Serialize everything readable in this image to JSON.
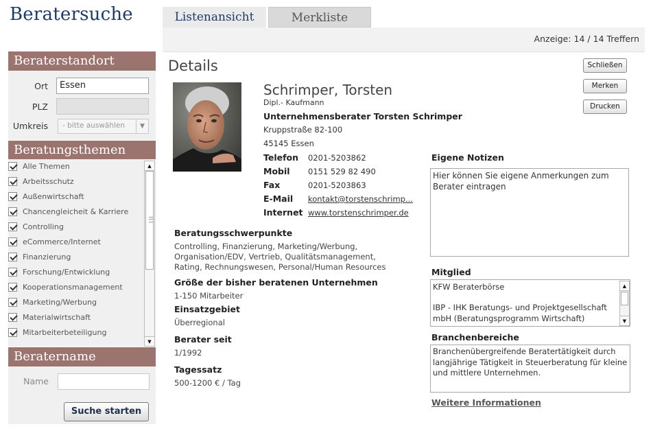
{
  "app": {
    "title": "Beratersuche"
  },
  "standort": {
    "heading": "Beraterstandort",
    "ort_label": "Ort",
    "ort_value": "Essen",
    "plz_label": "PLZ",
    "plz_value": "",
    "umkreis_label": "Umkreis",
    "umkreis_value": "- bitte auswählen"
  },
  "themen": {
    "heading": "Beratungsthemen",
    "items": [
      {
        "label": "Alle Themen",
        "checked": true
      },
      {
        "label": "Arbeitsschutz",
        "checked": true
      },
      {
        "label": "Außenwirtschaft",
        "checked": true
      },
      {
        "label": "Chancengleicheit & Karriere",
        "checked": true
      },
      {
        "label": "Controlling",
        "checked": true
      },
      {
        "label": "eCommerce/Internet",
        "checked": true
      },
      {
        "label": "Finanzierung",
        "checked": true
      },
      {
        "label": "Forschung/Entwicklung",
        "checked": true
      },
      {
        "label": "Kooperationsmanagement",
        "checked": true
      },
      {
        "label": "Marketing/Werbung",
        "checked": true
      },
      {
        "label": "Materialwirtschaft",
        "checked": true
      },
      {
        "label": "Mitarbeiterbeteiligung",
        "checked": true
      }
    ]
  },
  "beratername": {
    "heading": "Beratername",
    "name_label": "Name",
    "name_value": "",
    "search_button": "Suche starten"
  },
  "tabs": [
    {
      "label": "Listenansicht",
      "active": true
    },
    {
      "label": "Merkliste",
      "active": false
    }
  ],
  "anzeige": "Anzeige: 14 / 14 Treffern",
  "details": {
    "heading": "Details",
    "buttons": {
      "close": "Schließen",
      "remember": "Merken",
      "print": "Drucken"
    },
    "name": "Schrimper, Torsten",
    "degree": "Dipl.- Kaufmann",
    "company": "Unternehmensberater Torsten Schrimper",
    "street": "Kruppstraße 82-100",
    "city": "45145 Essen",
    "contacts": [
      {
        "label": "Telefon",
        "value": "0201-5203862"
      },
      {
        "label": "Mobil",
        "value": "0151 529 82 490"
      },
      {
        "label": "Fax",
        "value": "0201-5203863"
      },
      {
        "label": "E-Mail",
        "value": "kontakt@torstenschrimp..."
      },
      {
        "label": "Internet",
        "value": "www.torstenschrimper.de"
      }
    ],
    "schwerpunkte_label": "Beratungsschwerpunkte",
    "schwerpunkte_lines": [
      "Controlling, Finanzierung, Marketing/Werbung,",
      "Organisation/EDV, Vertrieb, Qualitätsmanagement,",
      "Rating, Rechnungswesen, Personal/Human Resources"
    ],
    "groesse_label": "Größe der bisher beratenen Unternehmen",
    "groesse_value": "1-150 Mitarbeiter",
    "einsatz_label": "Einsatzgebiet",
    "einsatz_value": "Überregional",
    "seit_label": "Berater seit",
    "seit_value": "1/1992",
    "tagessatz_label": "Tagessatz",
    "tagessatz_value": "500-1200 € / Tag",
    "notizen_label": "Eigene Notizen",
    "notizen_text": "Hier können Sie eigene Anmerkungen zum Berater eintragen",
    "mitglied_label": "Mitglied",
    "mitglied_line1": "KFW Beraterbörse",
    "mitglied_line2": "IBP - IHK Beratungs- und Projektgesellschaft mbH (Beratungsprogramm Wirtschaft)",
    "branchen_label": "Branchenbereiche",
    "branchen_text": "Branchenübergreifende Beratertätigkeit durch langjährige Tätigkeit in Steuerberatung für kleine und mittlere Unternehmen.",
    "more_link": "Weitere Informationen"
  },
  "colors": {
    "section_bar": "#9b7470",
    "title_blue": "#1f3b63"
  },
  "icons": {
    "checkbox": "checkmark-icon",
    "scroll_up": "arrow-up-icon",
    "scroll_down": "arrow-down-icon",
    "select": "chevron-down-icon"
  }
}
